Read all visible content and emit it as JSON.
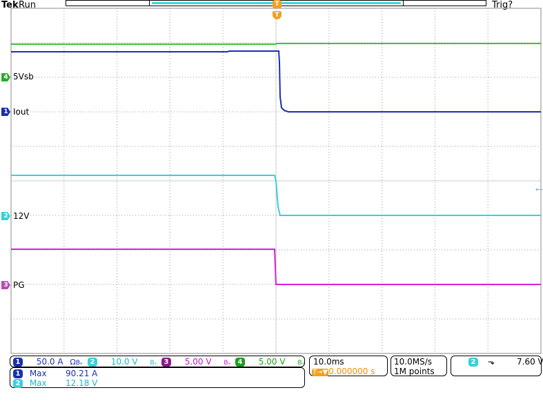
{
  "header": {
    "brand": "Tek",
    "run_state": "Run",
    "trigger_state": "Trig?"
  },
  "trigger_marker": {
    "label": "T"
  },
  "channel_labels": [
    {
      "marker": "4",
      "label": "5Vsb",
      "color": "#2fa82f"
    },
    {
      "marker": "1",
      "label": "Iout",
      "color": "#1a2fb0"
    },
    {
      "marker": "2",
      "label": "12V",
      "color": "#38d0d8"
    },
    {
      "marker": "3",
      "label": "PG",
      "color": "#b84ab8"
    }
  ],
  "channels": {
    "ch1": {
      "num": "1",
      "scale": "50.0 A",
      "extra": "Ω",
      "bw": "Bᵥ",
      "color": "#1a2fb0"
    },
    "ch2": {
      "num": "2",
      "scale": "10.0 V",
      "bw": "Bᵥ",
      "color": "#18b8c8"
    },
    "ch3": {
      "num": "3",
      "scale": "5.00 V",
      "bw": "Bᵥ",
      "color": "#8a1a8a"
    },
    "ch4": {
      "num": "4",
      "scale": "5.00 V",
      "bw": "Bᵥ",
      "color": "#1a9e1a"
    }
  },
  "measurements": [
    {
      "num": "1",
      "label": "Max",
      "value": "90.21 A"
    },
    {
      "num": "2",
      "label": "Max",
      "value": "12.18 V"
    }
  ],
  "timebase": {
    "scale": "10.0ms",
    "position_prefix": "T→▼",
    "position": "0.000000 s"
  },
  "acquisition": {
    "rate": "10.0MS/s",
    "length": "1M points"
  },
  "trigger": {
    "channel": "2",
    "slope": "⬎",
    "level": "7.60 V"
  }
}
